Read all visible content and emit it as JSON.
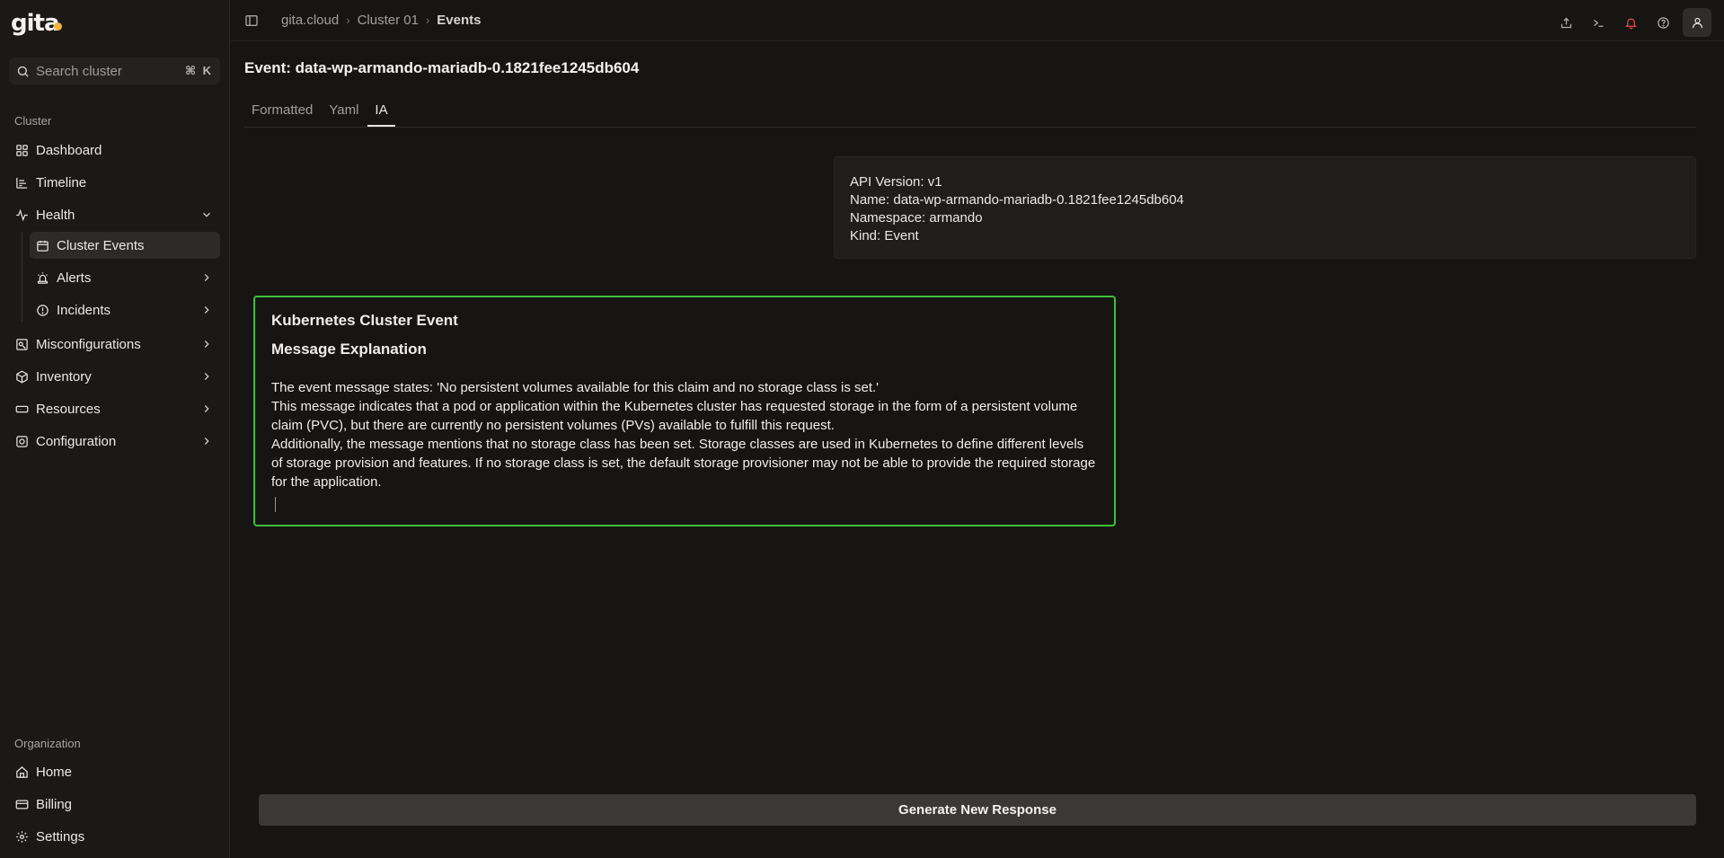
{
  "app": {
    "logo_text": "gita"
  },
  "sidebar": {
    "search_placeholder": "Search cluster",
    "search_shortcut": "⌘ K",
    "cluster_section": "Cluster",
    "items": [
      {
        "label": "Dashboard",
        "icon": "grid-icon"
      },
      {
        "label": "Timeline",
        "icon": "timeline-icon"
      },
      {
        "label": "Health",
        "icon": "pulse-icon",
        "expanded": true
      },
      {
        "label": "Cluster Events",
        "icon": "calendar-icon",
        "active": true
      },
      {
        "label": "Alerts",
        "icon": "siren-icon"
      },
      {
        "label": "Incidents",
        "icon": "alert-circle-icon"
      },
      {
        "label": "Misconfigurations",
        "icon": "settings-cog-icon"
      },
      {
        "label": "Inventory",
        "icon": "package-icon"
      },
      {
        "label": "Resources",
        "icon": "server-rack-icon"
      },
      {
        "label": "Configuration",
        "icon": "config-icon"
      }
    ],
    "org_section": "Organization",
    "org_items": [
      {
        "label": "Home",
        "icon": "home-icon"
      },
      {
        "label": "Billing",
        "icon": "credit-card-icon"
      },
      {
        "label": "Settings",
        "icon": "gear-icon"
      }
    ]
  },
  "breadcrumb": [
    "gita.cloud",
    "Cluster 01",
    "Events"
  ],
  "page": {
    "title": "Event: data-wp-armando-mariadb-0.1821fee1245db604",
    "tabs": [
      "Formatted",
      "Yaml",
      "IA"
    ],
    "active_tab": "IA"
  },
  "meta": {
    "lines": [
      "API Version: v1",
      "Name: data-wp-armando-mariadb-0.1821fee1245db604",
      "Namespace: armando",
      "Kind: Event"
    ]
  },
  "ai": {
    "heading1": "Kubernetes Cluster Event",
    "heading2": "Message Explanation",
    "p1": "The event message states: 'No persistent volumes available for this claim and no storage class is set.'",
    "p2": "This message indicates that a pod or application within the Kubernetes cluster has requested storage in the form of a persistent volume claim (PVC), but there are currently no persistent volumes (PVs) available to fulfill this request.",
    "p3": "Additionally, the message mentions that no storage class has been set. Storage classes are used in Kubernetes to define different levels of storage provision and features. If no storage class is set, the default storage provisioner may not be able to provide the required storage for the application."
  },
  "actions": {
    "generate_label": "Generate New Response"
  },
  "colors": {
    "accent_border": "#3fbf38",
    "notification": "#e5484d",
    "logo_dot": "#f0b53c"
  }
}
